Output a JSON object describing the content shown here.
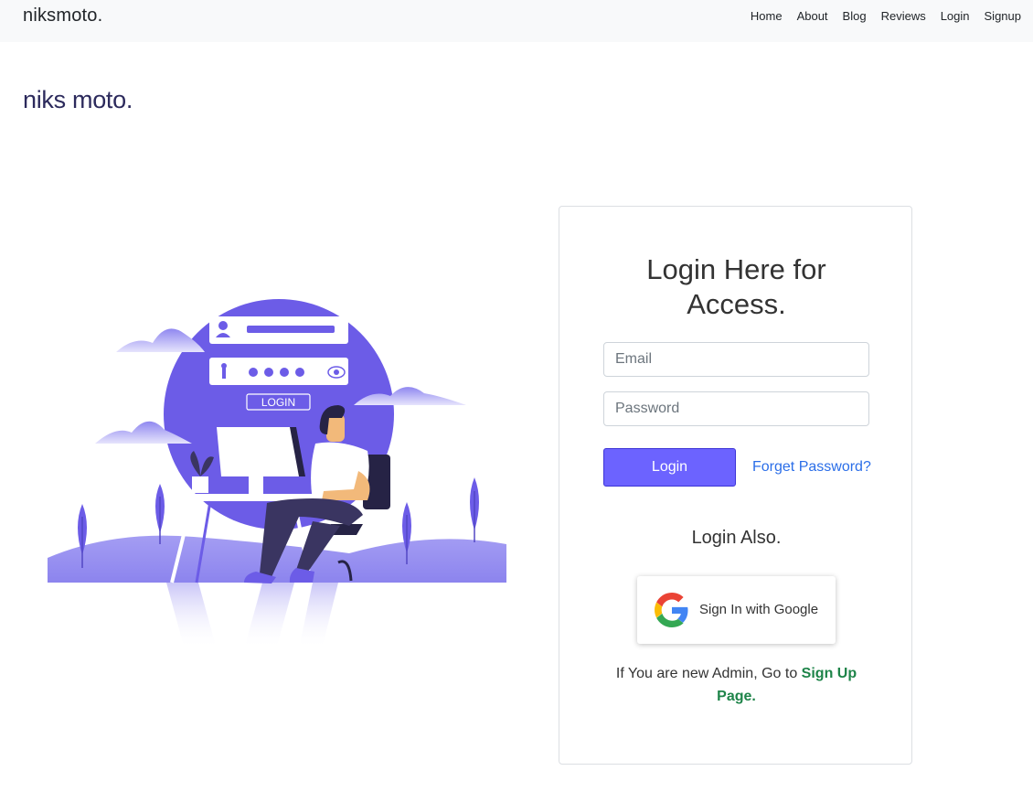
{
  "navbar": {
    "brand": "niksmoto.",
    "links": [
      "Home",
      "About",
      "Blog",
      "Reviews",
      "Login",
      "Signup"
    ]
  },
  "page_title": "niks moto.",
  "illustration": {
    "login_label": "LOGIN",
    "icon": "person-at-computer-illustration"
  },
  "login_card": {
    "title": "Login Here for Access.",
    "email_placeholder": "Email",
    "password_placeholder": "Password",
    "login_button": "Login",
    "forget_password": "Forget Password?",
    "login_also": "Login Also.",
    "google_button": "Sign In with Google",
    "signup_prefix": "If You are new Admin, Go to ",
    "signup_link": "Sign Up Page."
  },
  "colors": {
    "accent": "#6c63ff",
    "link": "#2b6ee8",
    "signup_link": "#1e8449",
    "title": "#2c2a5c"
  }
}
